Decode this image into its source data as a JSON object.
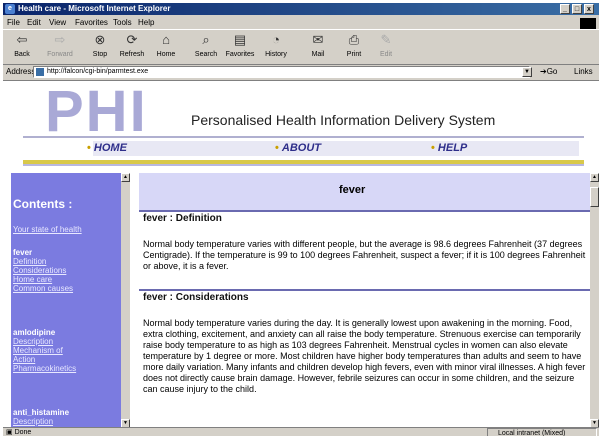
{
  "window": {
    "title": "Health care - Microsoft Internet Explorer"
  },
  "menu": [
    "File",
    "Edit",
    "View",
    "Favorites",
    "Tools",
    "Help"
  ],
  "toolbar": [
    {
      "label": "Back",
      "icon": "back-arrow-icon",
      "glyph": "⇦",
      "enabled": true
    },
    {
      "label": "Forward",
      "icon": "forward-arrow-icon",
      "glyph": "⇨",
      "enabled": false
    },
    {
      "label": "Stop",
      "icon": "stop-icon",
      "glyph": "⊗",
      "enabled": true
    },
    {
      "label": "Refresh",
      "icon": "refresh-icon",
      "glyph": "⟳",
      "enabled": true
    },
    {
      "label": "Home",
      "icon": "home-icon",
      "glyph": "⌂",
      "enabled": true
    },
    {
      "label": "Search",
      "icon": "search-icon",
      "glyph": "⌕",
      "enabled": true
    },
    {
      "label": "Favorites",
      "icon": "favorites-icon",
      "glyph": "▤",
      "enabled": true
    },
    {
      "label": "History",
      "icon": "history-icon",
      "glyph": "◔",
      "enabled": true
    },
    {
      "label": "Mail",
      "icon": "mail-icon",
      "glyph": "✉",
      "enabled": true
    },
    {
      "label": "Print",
      "icon": "print-icon",
      "glyph": "⎙",
      "enabled": true
    },
    {
      "label": "Edit",
      "icon": "edit-icon",
      "glyph": "✎",
      "enabled": false
    }
  ],
  "address": {
    "label": "Address",
    "url": "http://falcon/cgi-bin/parmtest.exe",
    "go": "Go",
    "links": "Links"
  },
  "site": {
    "logo": "PHI",
    "title": "Personalised Health Information Delivery System",
    "nav": [
      "HOME",
      "ABOUT",
      "HELP"
    ]
  },
  "sidebar": {
    "heading": "Contents :",
    "items": [
      {
        "text": "Your state of health",
        "kind": "link"
      },
      {
        "text": "fever",
        "kind": "bold"
      },
      {
        "text": "Definition",
        "kind": "link"
      },
      {
        "text": "Considerations",
        "kind": "link"
      },
      {
        "text": "Home care",
        "kind": "link"
      },
      {
        "text": "Common causes",
        "kind": "link"
      },
      {
        "text": "amlodipine",
        "kind": "bold"
      },
      {
        "text": "Description",
        "kind": "link"
      },
      {
        "text": "Mechanism of",
        "kind": "link"
      },
      {
        "text": "Action",
        "kind": "link"
      },
      {
        "text": "Pharmacokinetics",
        "kind": "link"
      },
      {
        "text": "anti_histamine",
        "kind": "bold"
      },
      {
        "text": "Description",
        "kind": "link"
      }
    ]
  },
  "content": {
    "topic": "fever",
    "sections": [
      {
        "heading": "fever : Definition",
        "body": "Normal body temperature varies with different people, but the average is 98.6 degrees Fahrenheit (37 degrees Centigrade). If the temperature is 99 to 100 degrees Fahrenheit, suspect a fever; if it is 100 degrees Fahrenheit or above, it is a fever."
      },
      {
        "heading": "fever : Considerations",
        "body": "Normal body temperature varies during the day. It is generally lowest upon awakening in the morning. Food, extra clothing, excitement, and anxiety can all raise the body temperature. Strenuous exercise can temporarily raise body temperature to as high as 103 degrees Fahrenheit. Menstrual cycles in women can also elevate temperature by 1 degree or more. Most children have higher body temperatures than adults and seem to have more daily variation. Many infants and children develop high fevers, even with minor viral illnesses. A high fever does not directly cause brain damage. However, febrile seizures can occur in some children, and the seizure can cause injury to the child."
      }
    ]
  },
  "status": {
    "left": "Done",
    "zone": "Local intranet (Mixed)"
  }
}
